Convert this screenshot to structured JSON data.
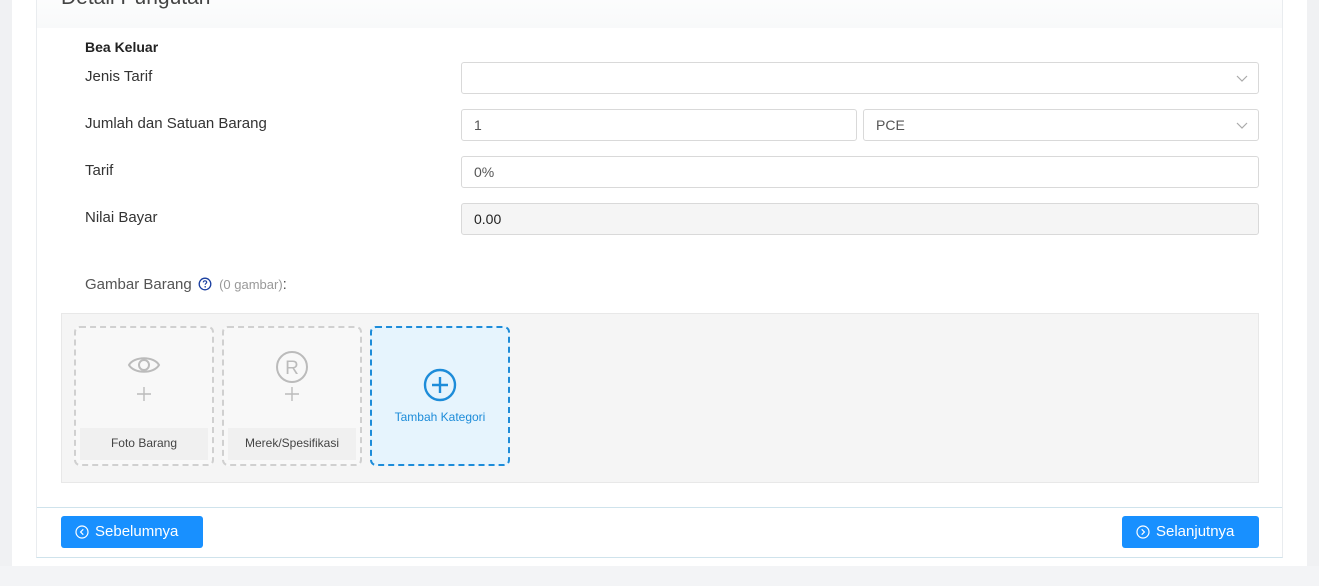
{
  "panel": {
    "title": "Detail Pungutan"
  },
  "section": {
    "title": "Bea Keluar"
  },
  "form": {
    "jenis_tarif_label": "Jenis Tarif",
    "jenis_tarif_value": "",
    "jumlah_label": "Jumlah dan Satuan Barang",
    "jumlah_value": "1",
    "satuan_value": "PCE",
    "tarif_label": "Tarif",
    "tarif_value": "0%",
    "nilai_bayar_label": "Nilai Bayar",
    "nilai_bayar_value": "0.00"
  },
  "gambar": {
    "label": "Gambar Barang",
    "count_text": "(0 gambar)",
    "colon": ":",
    "tiles": [
      {
        "label": "Foto Barang",
        "icon": "eye-icon"
      },
      {
        "label": "Merek/Spesifikasi",
        "icon": "registered-icon"
      }
    ],
    "add_label": "Tambah Kategori"
  },
  "nav": {
    "prev_label": "Sebelumnya",
    "next_label": "Selanjutnya"
  },
  "colors": {
    "primary": "#1890ff",
    "accent_border": "#1d8cd9",
    "help_icon": "#1a3fa0"
  }
}
